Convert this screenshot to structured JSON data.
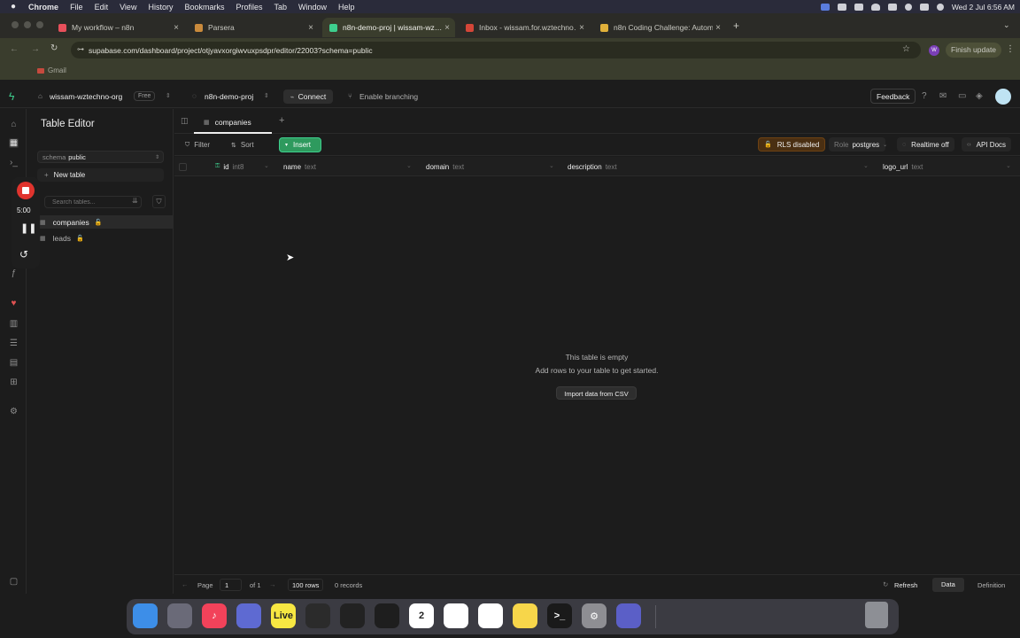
{
  "menubar": {
    "app": "Chrome",
    "items": [
      "File",
      "Edit",
      "View",
      "History",
      "Bookmarks",
      "Profiles",
      "Tab",
      "Window",
      "Help"
    ],
    "datetime": "Wed 2 Jul  6:56 AM"
  },
  "tabs": [
    {
      "label": "My workflow – n8n",
      "color": "#e8505b"
    },
    {
      "label": "Parsera",
      "color": "#c98a3c"
    },
    {
      "label": "n8n-demo-proj | wissam-wz…",
      "color": "#3ecf8e"
    },
    {
      "label": "Inbox - wissam.for.wztechno…",
      "color": "#d44638"
    },
    {
      "label": "n8n Coding Challenge: Autom…",
      "color": "#e0b03a"
    }
  ],
  "address_bar": {
    "url": "supabase.com/dashboard/project/otjyavxorgiwvuxpsdpr/editor/22003?schema=public",
    "profile": "W",
    "update_label": "Finish update"
  },
  "bookmarks": {
    "gmail": "Gmail"
  },
  "appbar": {
    "org": "wissam-wztechno-org",
    "plan": "Free",
    "project": "n8n-demo-proj",
    "connect": "Connect",
    "branching": "Enable branching",
    "feedback": "Feedback"
  },
  "sidebar": {
    "title": "Table Editor",
    "schema_label": "schema",
    "schema_value": "public",
    "new_table": "New table",
    "search_placeholder": "Search tables...",
    "tables": [
      {
        "name": "companies"
      },
      {
        "name": "leads"
      }
    ]
  },
  "recorder": {
    "time": "5:00"
  },
  "main": {
    "tab_label": "companies",
    "filter": "Filter",
    "sort": "Sort",
    "insert": "Insert",
    "rls": "RLS disabled",
    "role_label": "Role",
    "role_value": "postgres",
    "realtime": "Realtime off",
    "api_docs": "API Docs",
    "columns": [
      {
        "name": "id",
        "type": "int8"
      },
      {
        "name": "name",
        "type": "text"
      },
      {
        "name": "domain",
        "type": "text"
      },
      {
        "name": "description",
        "type": "text"
      },
      {
        "name": "logo_url",
        "type": "text"
      }
    ],
    "empty_title": "This table is empty",
    "empty_sub": "Add rows to your table to get started.",
    "import_csv": "Import data from CSV",
    "footer": {
      "page_label": "Page",
      "page_value": "1",
      "of_label": "of 1",
      "rows": "100 rows",
      "records": "0 records",
      "refresh": "Refresh",
      "data_tab": "Data",
      "definition_tab": "Definition"
    }
  },
  "dock": {
    "apps": [
      {
        "name": "Finder",
        "color": "#3d8ee8",
        "glyph": ""
      },
      {
        "name": "Launchpad",
        "color": "#6a6a78",
        "glyph": ""
      },
      {
        "name": "Music",
        "color": "#f2425a",
        "glyph": "♪"
      },
      {
        "name": "Arc",
        "color": "#5e6ad2",
        "glyph": ""
      },
      {
        "name": "Live",
        "color": "#f7e742",
        "glyph": "Live"
      },
      {
        "name": "Piano",
        "color": "#2b2b2b",
        "glyph": ""
      },
      {
        "name": "Unity",
        "color": "#222222",
        "glyph": ""
      },
      {
        "name": "Cursor",
        "color": "#1e1e1e",
        "glyph": ""
      },
      {
        "name": "Calendar",
        "color": "#ffffff",
        "glyph": "2"
      },
      {
        "name": "Chrome",
        "color": "#ffffff",
        "glyph": ""
      },
      {
        "name": "Slack",
        "color": "#ffffff",
        "glyph": ""
      },
      {
        "name": "Notes",
        "color": "#f7d64a",
        "glyph": ""
      },
      {
        "name": "Terminal",
        "color": "#1a1a1a",
        "glyph": ">_"
      },
      {
        "name": "Settings",
        "color": "#8e8e93",
        "glyph": "⚙"
      },
      {
        "name": "Teams",
        "color": "#5b5fc7",
        "glyph": ""
      }
    ]
  }
}
